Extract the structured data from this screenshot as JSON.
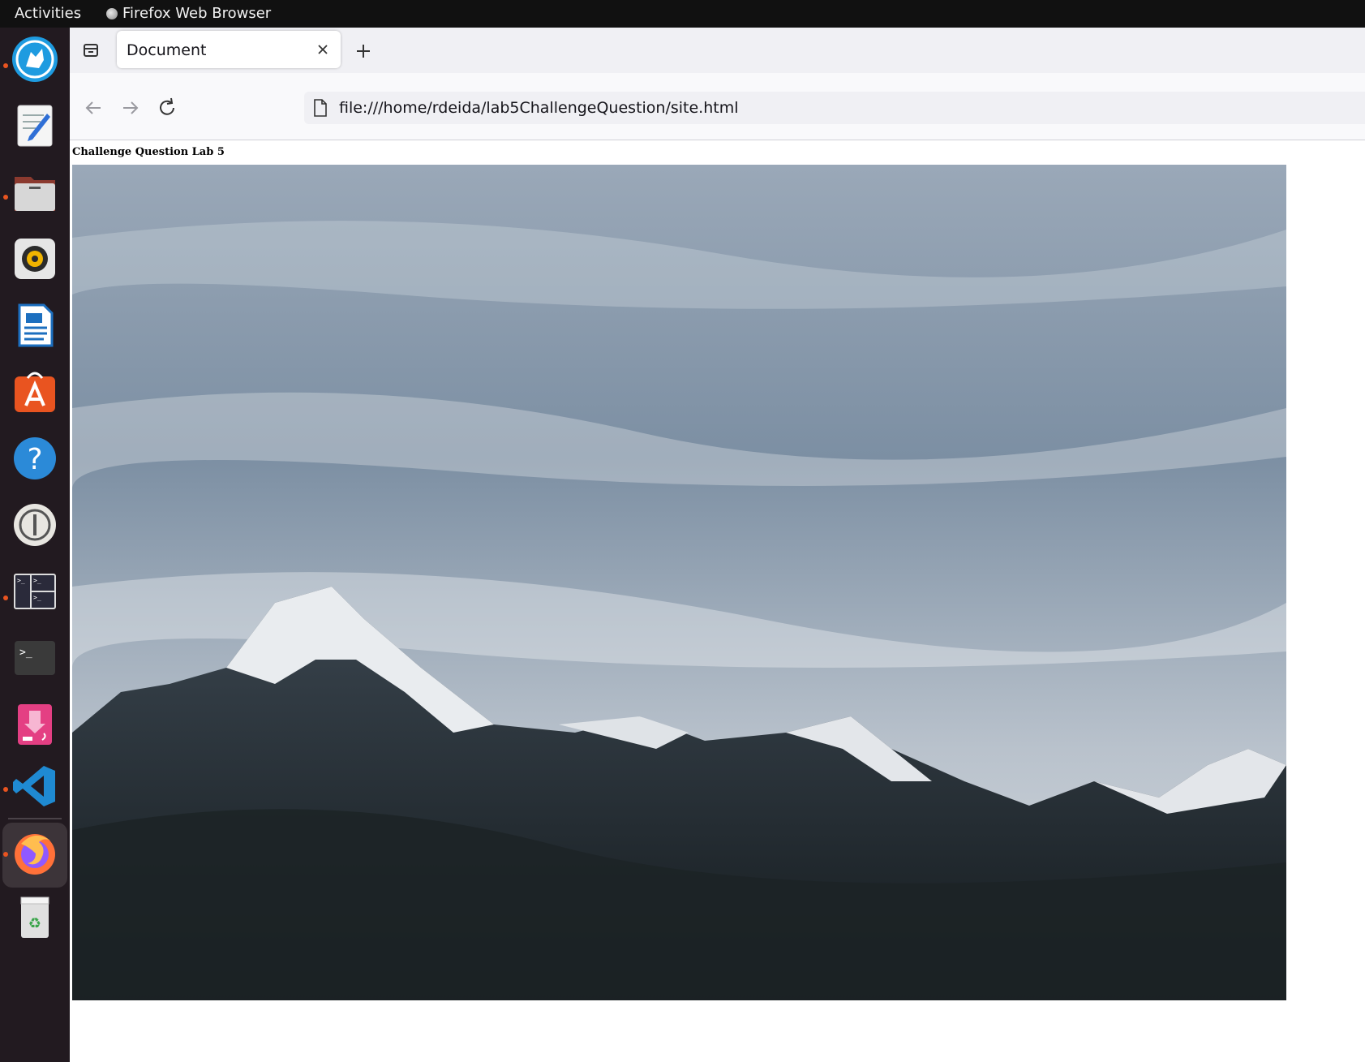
{
  "system_bar": {
    "activities": "Activities",
    "app_name": "Firefox Web Browser"
  },
  "dock": {
    "items": [
      {
        "name": "app-launcher-wolf",
        "running": true
      },
      {
        "name": "text-editor",
        "running": false
      },
      {
        "name": "files",
        "running": true
      },
      {
        "name": "rhythmbox",
        "running": false
      },
      {
        "name": "libreoffice-writer",
        "running": false
      },
      {
        "name": "ubuntu-software",
        "running": false
      },
      {
        "name": "help",
        "running": false
      },
      {
        "name": "password-manager",
        "running": false
      },
      {
        "name": "tilix-terminal",
        "running": true
      },
      {
        "name": "terminal",
        "running": false
      },
      {
        "name": "debian-installer",
        "running": false
      },
      {
        "name": "vscode",
        "running": true
      },
      {
        "name": "firefox",
        "running": true,
        "active": true
      },
      {
        "name": "trash",
        "running": false
      }
    ]
  },
  "browser": {
    "tab_title": "Document",
    "url": "file:///home/rdeida/lab5ChallengeQuestion/site.html"
  },
  "page": {
    "heading": "Challenge Question Lab 5"
  },
  "colors": {
    "accent": "#e95420",
    "dock_bg": "#221a20",
    "topbar_bg": "#111111"
  }
}
